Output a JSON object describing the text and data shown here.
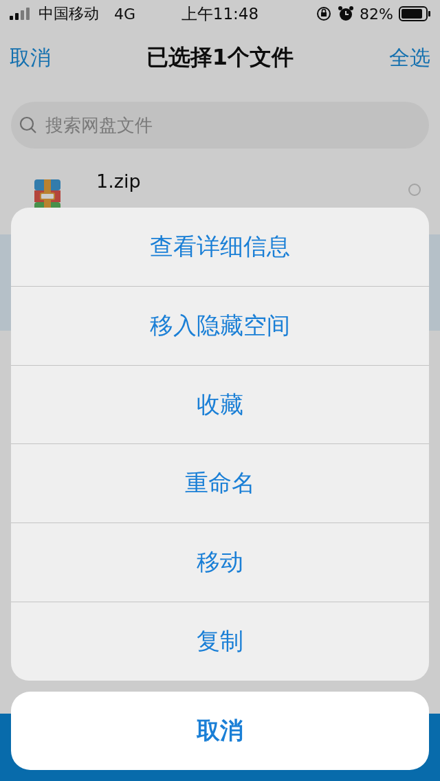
{
  "status_bar": {
    "carrier": "中国移动",
    "network": "4G",
    "time": "上午11:48",
    "battery": "82%"
  },
  "nav": {
    "cancel": "取消",
    "title": "已选择1个文件",
    "select_all": "全选"
  },
  "search": {
    "placeholder": "搜索网盘文件"
  },
  "files": [
    {
      "name": "1.zip",
      "selected": false
    }
  ],
  "action_sheet": {
    "actions": [
      "查看详细信息",
      "移入隐藏空间",
      "收藏",
      "重命名",
      "移动",
      "复制"
    ],
    "cancel": "取消"
  }
}
